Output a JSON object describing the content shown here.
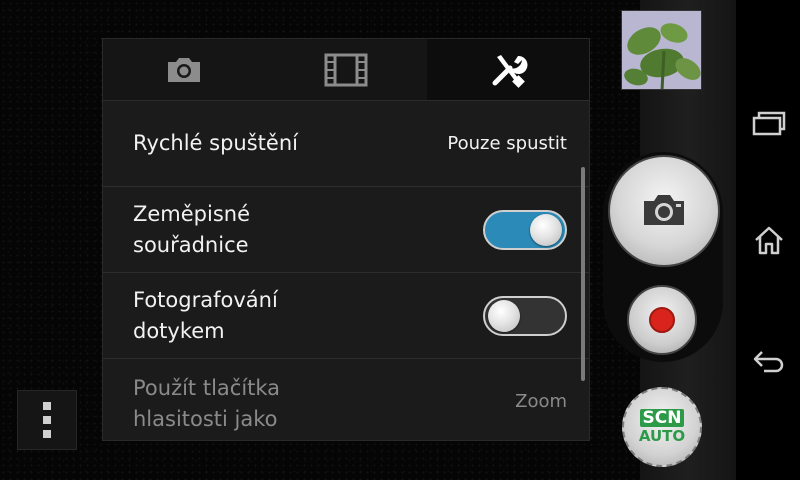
{
  "tabs": [
    {
      "name": "camera-tab",
      "icon": "camera-icon",
      "active": false
    },
    {
      "name": "video-tab",
      "icon": "film-icon",
      "active": false
    },
    {
      "name": "settings-tab",
      "icon": "tools-icon",
      "active": true
    }
  ],
  "settings": {
    "quick_launch": {
      "label": "Rychlé spuštění",
      "value": "Pouze spustit"
    },
    "geotag": {
      "label_line1": "Zeměpisné",
      "label_line2": "souřadnice",
      "state": "on"
    },
    "touch_capture": {
      "label_line1": "Fotografování",
      "label_line2": "dotykem",
      "state": "off"
    },
    "volume_keys": {
      "label_line1": "Použít tlačítka",
      "label_line2": "hlasitosti jako",
      "value": "Zoom"
    }
  },
  "controls": {
    "scene_top": "SCN",
    "scene_bottom": "AUTO",
    "accent_toggle": "#2b8ab7",
    "record_color": "#d9241c",
    "scene_color": "#2d9a47"
  },
  "icons": {
    "shutter": "camera-icon",
    "record": "record-icon",
    "menu": "overflow-menu-icon",
    "nav_recent": "recent-apps-icon",
    "nav_home": "home-icon",
    "nav_back": "back-icon"
  }
}
